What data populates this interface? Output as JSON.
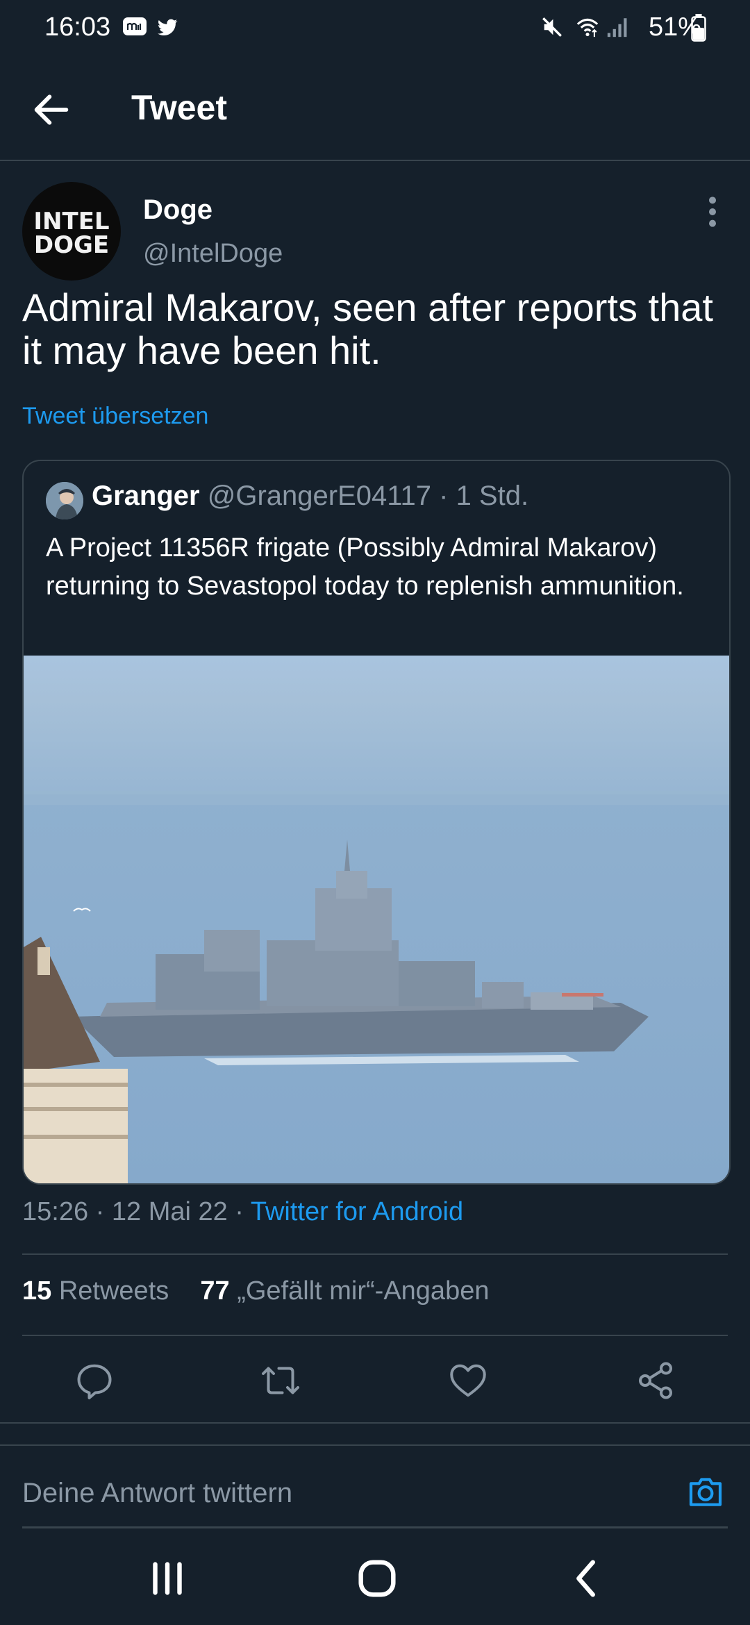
{
  "status_bar": {
    "time": "16:03",
    "battery": "51%",
    "left_icons": [
      "messages-icon",
      "twitter-bird-icon"
    ],
    "right_icons": [
      "mute-icon",
      "wifi-icon",
      "signal-icon",
      "battery-icon"
    ]
  },
  "header": {
    "title": "Tweet"
  },
  "tweet": {
    "author": {
      "name": "Doge",
      "handle": "@IntelDoge",
      "avatar_line1": "INTEL",
      "avatar_line2": "DOGE"
    },
    "text": "Admiral Makarov, seen after reports that it may have been hit.",
    "translate_label": "Tweet übersetzen",
    "quote": {
      "name": "Granger",
      "handle_time": "@GrangerE04117 · 1 Std.",
      "text": "A Project 11356R frigate (Possibly Admiral Makarov) returning to Sevastopol today to replenish ammunition."
    },
    "timestamp": "15:26 · 12 Mai 22 · ",
    "client": "Twitter for Android",
    "stats": {
      "retweets_count": "15",
      "retweets_label": "Retweets",
      "likes_count": "77",
      "likes_label": "„Gefällt mir“-Angaben"
    },
    "actions": [
      "reply-icon",
      "retweet-icon",
      "like-icon",
      "share-icon"
    ]
  },
  "reply": {
    "placeholder": "Deine Antwort twittern"
  },
  "colors": {
    "background": "#15202b",
    "accent": "#1d9bf0",
    "muted_text": "#8b98a5",
    "divider": "#38444d"
  }
}
